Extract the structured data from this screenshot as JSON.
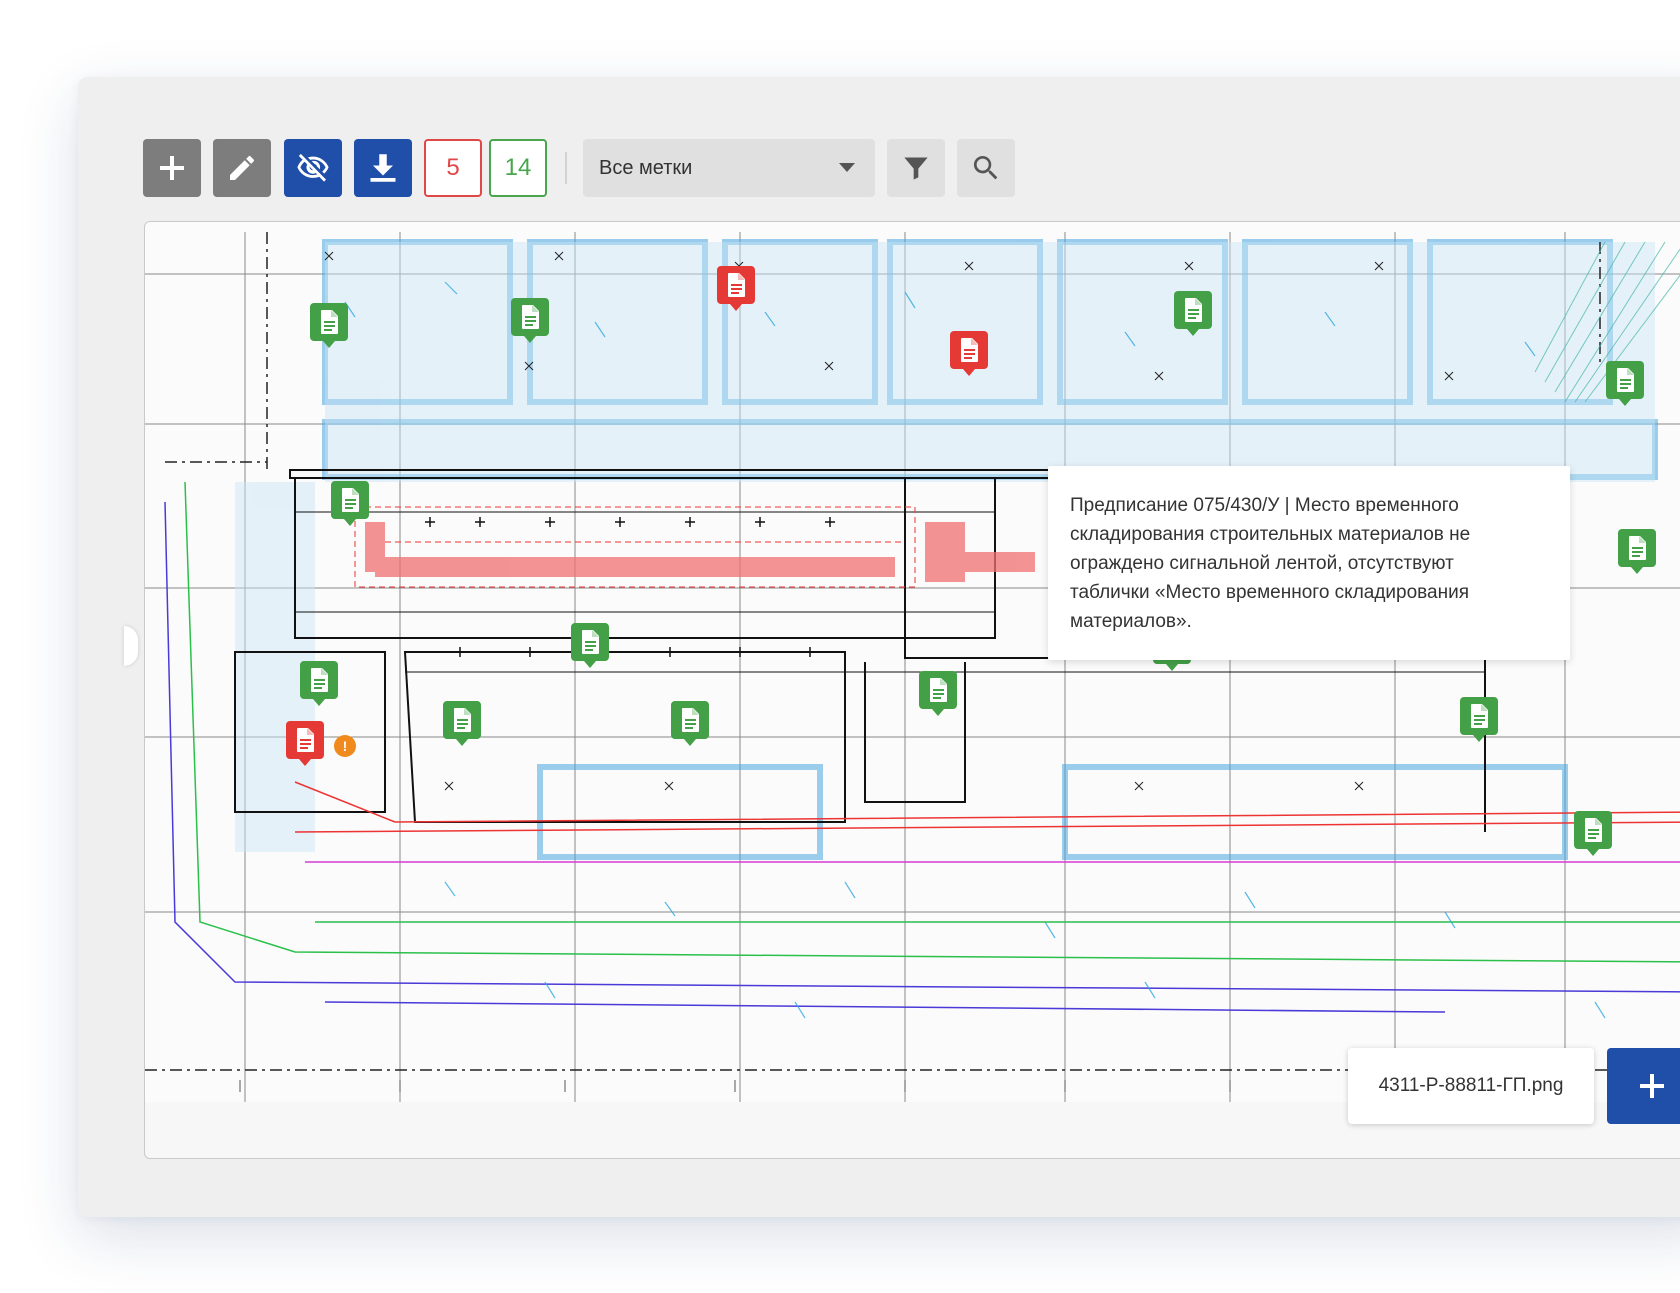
{
  "colors": {
    "gray_button": "#7d7d7d",
    "blue_button": "#1f4fa9",
    "count_red": "#e04848",
    "count_green": "#49a64c",
    "marker_green": "#43a047",
    "marker_red": "#e53935",
    "marker_selected_border": "#1f4fa9",
    "warning_badge": "#f08a1c"
  },
  "toolbar": {
    "add_icon": "plus-icon",
    "edit_icon": "pencil-icon",
    "visibility_icon": "eye-off-icon",
    "download_icon": "download-icon",
    "red_count": "5",
    "green_count": "14",
    "marks_select": {
      "selected": "Все метки"
    },
    "filter_icon": "filter-icon",
    "search_icon": "search-icon"
  },
  "map": {
    "markers": [
      {
        "status": "green",
        "icon": "document-icon"
      },
      {
        "status": "green",
        "icon": "document-icon"
      },
      {
        "status": "red",
        "icon": "document-icon"
      },
      {
        "status": "red",
        "icon": "document-icon"
      },
      {
        "status": "green",
        "icon": "document-icon"
      },
      {
        "status": "green",
        "icon": "document-icon"
      },
      {
        "status": "green",
        "icon": "document-icon"
      },
      {
        "status": "green",
        "icon": "document-icon"
      },
      {
        "status": "green",
        "icon": "document-icon"
      },
      {
        "status": "red",
        "icon": "document-icon",
        "selected": true
      },
      {
        "status": "green",
        "icon": "document-icon"
      },
      {
        "status": "green",
        "icon": "document-icon"
      },
      {
        "status": "green",
        "icon": "document-icon"
      },
      {
        "status": "red",
        "icon": "document-icon"
      },
      {
        "status": "green",
        "icon": "document-icon"
      },
      {
        "status": "green",
        "icon": "document-icon"
      },
      {
        "status": "green",
        "icon": "document-icon"
      },
      {
        "status": "green",
        "icon": "document-icon"
      }
    ],
    "warning_badge": "!",
    "tooltip": {
      "lines": [
        "Предписание 075/430/У | Место временного",
        "складирования строительных материалов не",
        "ограждено сигнальной лентой, отсутствуют",
        "таблички «Место временного складирования",
        "материалов»."
      ]
    },
    "file_name": "4311-Р-88811-ГП.png",
    "add_button_icon": "plus-icon"
  }
}
